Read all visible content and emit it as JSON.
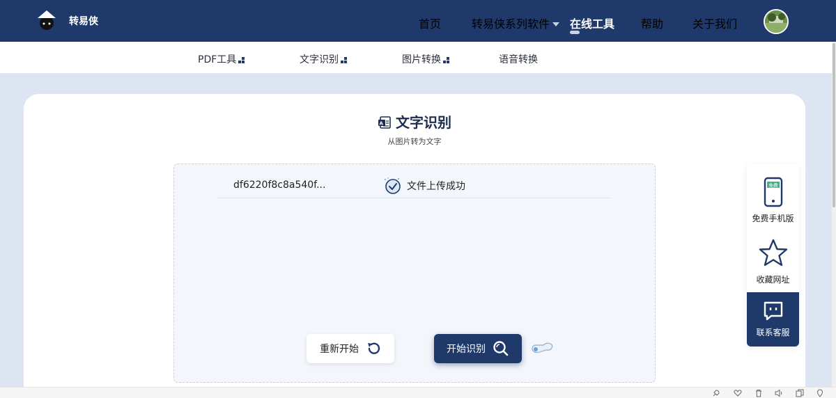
{
  "header": {
    "brand": "转易侠",
    "nav": [
      {
        "label": "首页"
      },
      {
        "label": "转易侠系列软件"
      },
      {
        "label": "在线工具"
      },
      {
        "label": "帮助"
      },
      {
        "label": "关于我们"
      }
    ]
  },
  "subnav": [
    {
      "label": "PDF工具"
    },
    {
      "label": "文字识别"
    },
    {
      "label": "图片转换"
    },
    {
      "label": "语音转换"
    }
  ],
  "main": {
    "title": "文字识别",
    "subtitle": "从图片转为文字",
    "file": {
      "name": "df6220f8c8a540f...",
      "status": "文件上传成功"
    },
    "reset_label": "重新开始",
    "start_label": "开始识别"
  },
  "float_panel": {
    "mobile_badge": "免费",
    "mobile": "免费手机版",
    "favorite": "收藏网址",
    "service": "联系客服"
  },
  "colors": {
    "primary": "#1f3a6a",
    "page_bg": "#dde5f3",
    "upload_bg": "#f3f6fb"
  }
}
